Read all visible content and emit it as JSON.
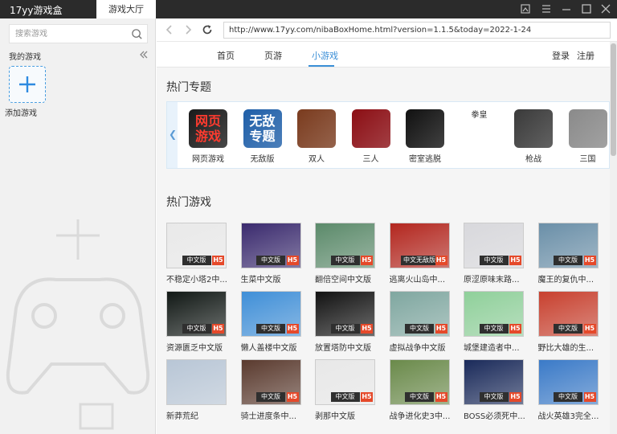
{
  "window": {
    "app_title": "17yy游戏盒",
    "main_tab": "游戏大厅"
  },
  "sidebar": {
    "search_placeholder": "搜索游戏",
    "my_games_label": "我的游戏",
    "add_game_label": "添加游戏"
  },
  "addressbar": {
    "url": "http://www.17yy.com/nibaBoxHome.html?version=1.1.5&today=2022-1-24"
  },
  "nav": {
    "tabs": [
      {
        "label": "首页",
        "active": false
      },
      {
        "label": "页游",
        "active": false
      },
      {
        "label": "小游戏",
        "active": true
      }
    ],
    "login_label": "登录",
    "register_label": "注册"
  },
  "topics": {
    "title": "热门专题",
    "items": [
      {
        "label": "网页游戏",
        "icon_text": "网页游戏",
        "color": "#1a1a1a",
        "text_color": "#ff3b2f"
      },
      {
        "label": "无敌版",
        "icon_text": "无敌专题",
        "color": "#1f5fa8",
        "text_color": "#ffffff"
      },
      {
        "label": "双人",
        "icon_text": "",
        "color": "#7a3b1e",
        "text_color": "#ffffff"
      },
      {
        "label": "三人",
        "icon_text": "",
        "color": "#8b0e14",
        "text_color": "#ffffff"
      },
      {
        "label": "密室逃脱",
        "icon_text": "",
        "color": "#111111",
        "text_color": "#ffffff"
      },
      {
        "label": "拳皇",
        "icon_text": "",
        "color": "#ffffff",
        "text_color": "#333333"
      },
      {
        "label": "枪战",
        "icon_text": "",
        "color": "#3a3a3a",
        "text_color": "#ffffff"
      },
      {
        "label": "三国",
        "icon_text": "",
        "color": "#8a8a8a",
        "text_color": "#ffffff"
      }
    ]
  },
  "games": {
    "title": "热门游戏",
    "badge_cn": "中文版",
    "badge_h5": "H5",
    "items": [
      {
        "title": "不稳定小塔2中...",
        "badge": "中文版",
        "h5": true,
        "color": "#e9e9e9"
      },
      {
        "title": "生菜中文版",
        "badge": "中文版",
        "h5": true,
        "color": "#3a2a6e"
      },
      {
        "title": "翻倍空间中文版",
        "badge": "中文版",
        "h5": true,
        "color": "#5b8a6a"
      },
      {
        "title": "逃离火山岛中...",
        "badge": "中文无敌版",
        "h5": true,
        "color": "#b3261e"
      },
      {
        "title": "原涩原味末路...",
        "badge": "中文版",
        "h5": true,
        "color": "#d8d8dc"
      },
      {
        "title": "魔王的复仇中...",
        "badge": "中文版",
        "h5": true,
        "color": "#6a8fa8"
      },
      {
        "title": "资源匮乏中文版",
        "badge": "中文版",
        "h5": true,
        "color": "#111815"
      },
      {
        "title": "懒人盖楼中文版",
        "badge": "中文版",
        "h5": true,
        "color": "#3f8fd8"
      },
      {
        "title": "放置塔防中文版",
        "badge": "中文版",
        "h5": true,
        "color": "#121212"
      },
      {
        "title": "虚拟战争中文版",
        "badge": "中文版",
        "h5": true,
        "color": "#7fa7a0"
      },
      {
        "title": "城堡建造者中...",
        "badge": "中文版",
        "h5": true,
        "color": "#8fd09a"
      },
      {
        "title": "野比大雄的生...",
        "badge": "中文版",
        "h5": true,
        "color": "#c8402e"
      },
      {
        "title": "新莽荒纪",
        "badge": "",
        "h5": false,
        "color": "#b8c6d6"
      },
      {
        "title": "骑士进度条中...",
        "badge": "中文版",
        "h5": true,
        "color": "#5a3a2e"
      },
      {
        "title": "剥那中文版",
        "badge": "中文版",
        "h5": true,
        "color": "#e8e8e8"
      },
      {
        "title": "战争进化史3中...",
        "badge": "中文版",
        "h5": true,
        "color": "#6a8a4a"
      },
      {
        "title": "BOSS必须死中...",
        "badge": "中文版",
        "h5": true,
        "color": "#1a2a5a"
      },
      {
        "title": "战火英雄3完全...",
        "badge": "中文版",
        "h5": true,
        "color": "#3a7ac8"
      }
    ]
  }
}
